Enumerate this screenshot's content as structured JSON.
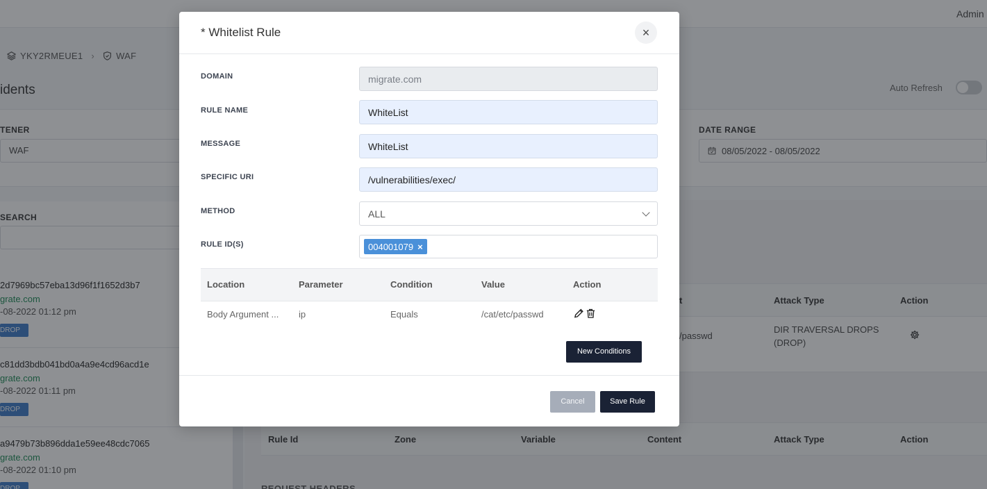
{
  "background": {
    "topbar": {
      "user": "Admin"
    },
    "breadcrumb": {
      "cluster": "YKY2RMEUE1",
      "section": "WAF"
    },
    "page_title": "idents",
    "auto_refresh_label": "Auto Refresh",
    "filters": {
      "listener_label": "TENER",
      "listener_value": "WAF",
      "date_range_label": "DATE RANGE",
      "date_range_value": "08/05/2022 - 08/05/2022",
      "search_label": "SEARCH"
    },
    "incidents": [
      {
        "hash": "2d7969bc57eba13d96f1f1652d3b7",
        "domain": "grate.com",
        "time": "-08-2022 01:12 pm",
        "badge": "DROP"
      },
      {
        "hash": "c81dd3bdb041bd0a4a9e4cd96acd1e",
        "domain": "grate.com",
        "time": "-08-2022 01:11 pm",
        "badge": "DROP"
      },
      {
        "hash": "a9479b73b896dda1e59ee48cdc7065",
        "domain": "grate.com",
        "time": "-08-2022 01:10 pm",
        "badge": "DROP"
      }
    ],
    "table1": {
      "columns": {
        "content": "t",
        "attack_type": "Attack Type",
        "action": "Action"
      },
      "row": {
        "content": "/passwd",
        "attack_type_line1": "DIR TRAVERSAL DROPS",
        "attack_type_line2": "(DROP)"
      }
    },
    "table2": {
      "columns": [
        "Rule Id",
        "Zone",
        "Variable",
        "Content",
        "Attack Type",
        "Action"
      ]
    },
    "section_footer": "REQUEST HEADERS"
  },
  "modal": {
    "title": "* Whitelist Rule",
    "close": "×",
    "fields": {
      "domain": {
        "label": "DOMAIN",
        "value": "migrate.com"
      },
      "rule_name": {
        "label": "RULE NAME",
        "value": "WhiteList"
      },
      "message": {
        "label": "MESSAGE",
        "value": "WhiteList"
      },
      "specific_uri": {
        "label": "SPECIFIC URI",
        "value": "/vulnerabilities/exec/"
      },
      "method": {
        "label": "METHOD",
        "value": "ALL"
      },
      "rule_ids": {
        "label": "RULE ID(S)",
        "tag": "004001079",
        "tag_remove": "×"
      }
    },
    "conditions": {
      "columns": [
        "Location",
        "Parameter",
        "Condition",
        "Value",
        "Action"
      ],
      "rows": [
        {
          "location": "Body Argument ...",
          "parameter": "ip",
          "condition": "Equals",
          "value": "/cat/etc/passwd"
        }
      ]
    },
    "new_conditions_label": "New Conditions",
    "cancel_label": "Cancel",
    "save_label": "Save Rule"
  }
}
